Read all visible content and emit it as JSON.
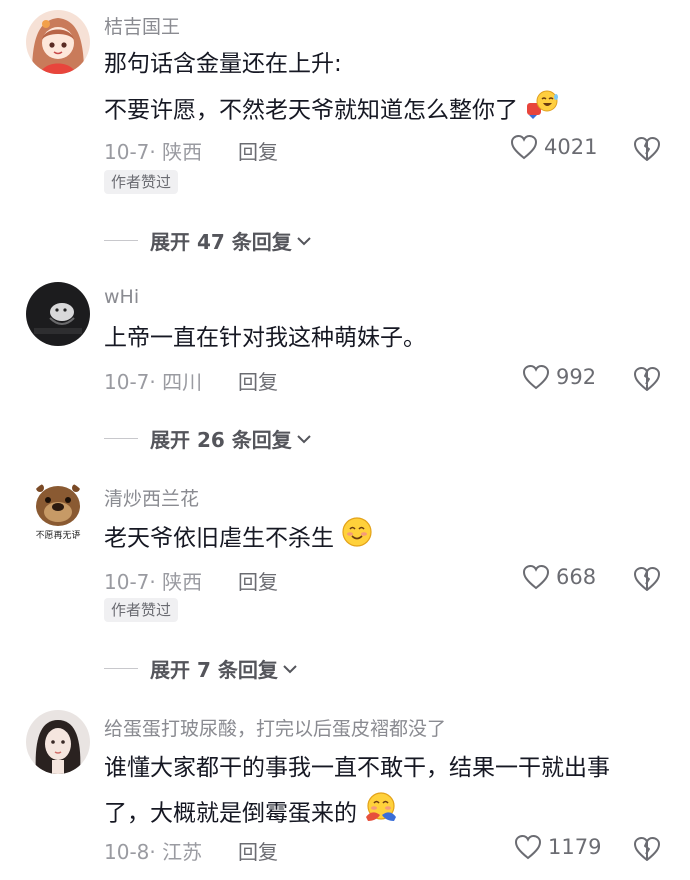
{
  "comments": [
    {
      "username": "桔吉国王",
      "text_lines": [
        "那句话含金量还在上升:",
        "不要许愿，不然老天爷就知道怎么整你了"
      ],
      "emoji": "laughing-emoji",
      "meta": "10-7· 陕西",
      "reply_label": "回复",
      "likes": "4021",
      "badge": "作者赞过",
      "expand_label": "展开 47 条回复"
    },
    {
      "username": "wHi",
      "text_lines": [
        "上帝一直在针对我这种萌妹子。"
      ],
      "meta": "10-7· 四川",
      "reply_label": "回复",
      "likes": "992",
      "expand_label": "展开 26 条回复"
    },
    {
      "username": "清炒西兰花",
      "text_lines": [
        "老天爷依旧虐生不杀生"
      ],
      "emoji": "blushing-smile-emoji",
      "avatar_caption": "不愿再无语",
      "meta": "10-7· 陕西",
      "reply_label": "回复",
      "likes": "668",
      "badge": "作者赞过",
      "expand_label": "展开 7 条回复"
    },
    {
      "username": "给蛋蛋打玻尿酸，打完以后蛋皮褶都没了",
      "text_lines": [
        "谁懂大家都干的事我一直不敢干，结果一干就出事",
        "了，大概就是倒霉蛋来的"
      ],
      "emoji": "hugging-face-emoji",
      "meta": "10-8· 江苏",
      "reply_label": "回复",
      "likes": "1179"
    }
  ],
  "colors": {
    "text": "#161823",
    "secondary": "#8a8b91",
    "badge_bg": "#f0f0f2"
  }
}
